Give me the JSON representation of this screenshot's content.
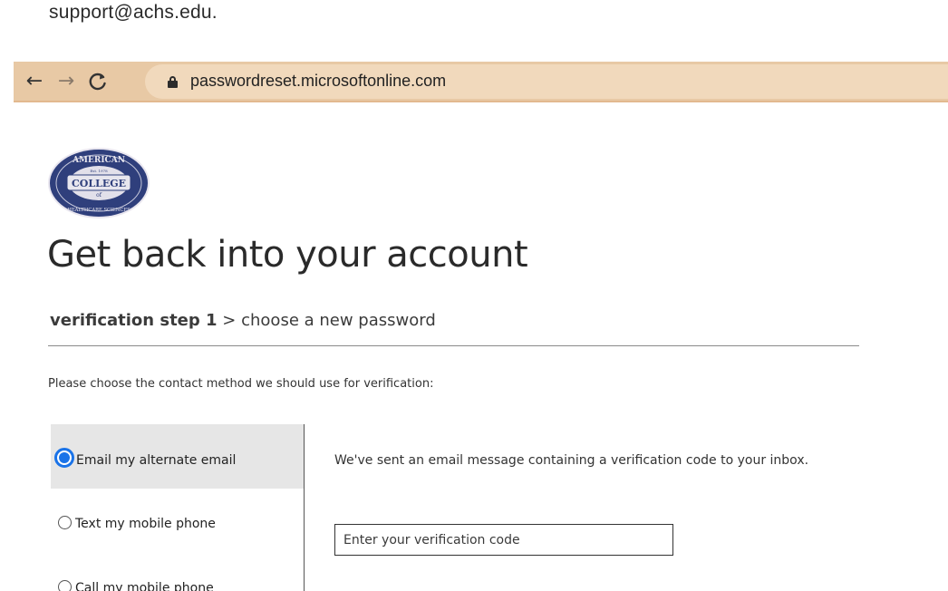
{
  "top_text": "support@achs.edu.",
  "browser": {
    "back_icon": "←",
    "forward_icon": "→",
    "reload_icon": "C",
    "url": "passwordreset.microsoftonline.com",
    "bar_color": "#e8c9a5"
  },
  "logo": {
    "line1": "AMERICAN",
    "line2": "Est. 1978",
    "line3": "COLLEGE",
    "line4": "of",
    "line5": "HEALTHCARE SCIENCES"
  },
  "page": {
    "title": "Get back into your account",
    "steps": {
      "active": "verification step 1",
      "separator": " > ",
      "next": "choose a new password"
    },
    "instruction": "Please choose the contact method we should use for verification:"
  },
  "methods": [
    {
      "label": "Email my alternate email",
      "selected": true
    },
    {
      "label": "Text my mobile phone",
      "selected": false
    },
    {
      "label": "Call my mobile phone",
      "selected": false
    }
  ],
  "detail": {
    "message": "We've sent an email message containing a verification code to your inbox.",
    "code_placeholder": "Enter your verification code"
  },
  "colors": {
    "accent": "#1a73e8",
    "selected_bg": "#e6e6e6"
  }
}
